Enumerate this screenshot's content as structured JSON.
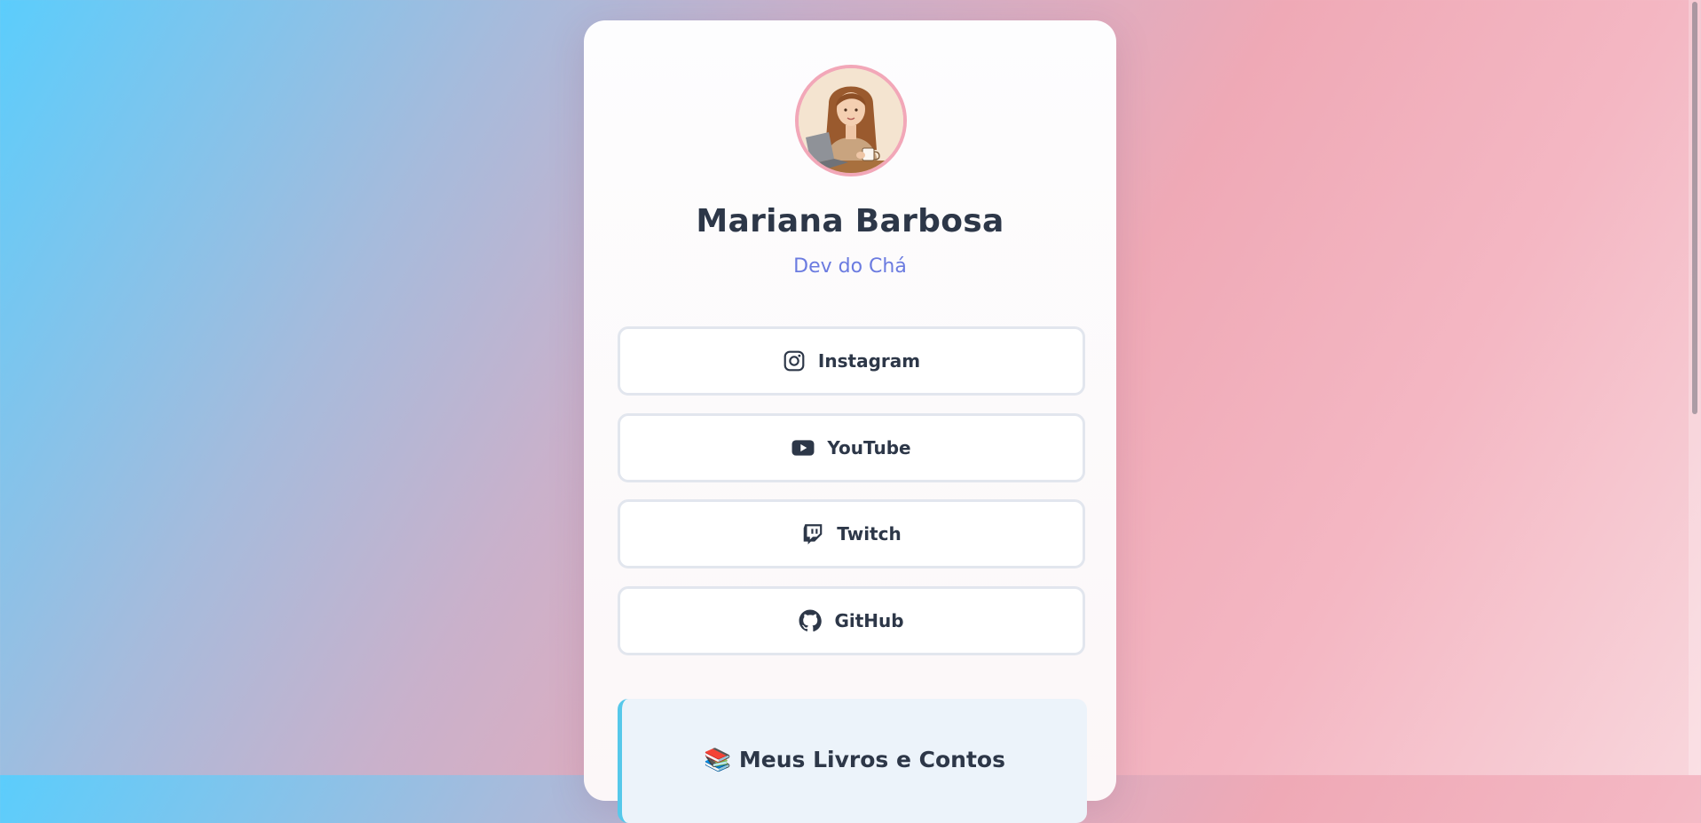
{
  "profile": {
    "name": "Mariana Barbosa",
    "subtitle": "Dev do Chá",
    "avatar_icon": "avatar-illustration"
  },
  "links": [
    {
      "label": "Instagram",
      "icon": "instagram-icon"
    },
    {
      "label": "YouTube",
      "icon": "youtube-icon"
    },
    {
      "label": "Twitch",
      "icon": "twitch-icon"
    },
    {
      "label": "GitHub",
      "icon": "github-icon"
    }
  ],
  "books": {
    "title": "📚 Meus Livros e Contos",
    "accent": "#56c8ea"
  },
  "colors": {
    "name": "#2d3748",
    "subtitle": "#6b7be0",
    "avatar_border": "#f2a7b8"
  }
}
